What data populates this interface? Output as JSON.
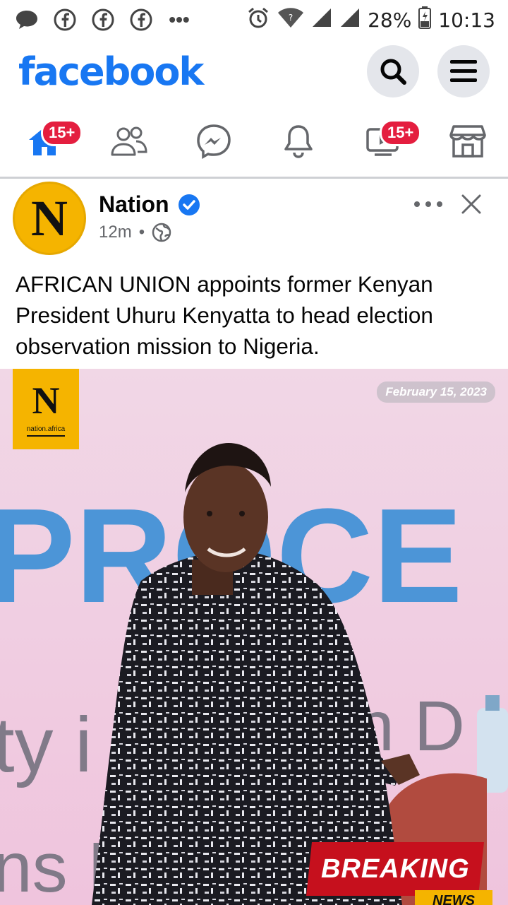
{
  "status_bar": {
    "battery": "28%",
    "time": "10:13",
    "overflow": "•••",
    "icons": [
      "chat-bubble-icon",
      "facebook-notification-icon",
      "facebook-notification-icon",
      "facebook-notification-icon",
      "alarm-icon",
      "wifi-icon",
      "signal-icon",
      "signal-icon",
      "battery-icon"
    ]
  },
  "header": {
    "logo": "facebook",
    "brand_color": "#1877f2"
  },
  "nav": {
    "home_badge": "15+",
    "video_badge": "15+",
    "tabs": [
      "home-icon",
      "friends-icon",
      "messenger-icon",
      "notifications-icon",
      "video-icon",
      "marketplace-icon"
    ]
  },
  "post": {
    "avatar_letter": "N",
    "page_name": "Nation",
    "time": "12m",
    "separator": "•",
    "text": "AFRICAN UNION appoints former Kenyan President Uhuru Kenyatta to head election observation mission to Nigeria.",
    "image": {
      "logo_letter": "N",
      "logo_domain": "nation.africa",
      "date": "February 15, 2023",
      "breaking": "BREAKING",
      "news": "NEWS",
      "background_words": [
        "PROCE",
        "ty i",
        "rn D",
        "ns I'"
      ]
    }
  }
}
